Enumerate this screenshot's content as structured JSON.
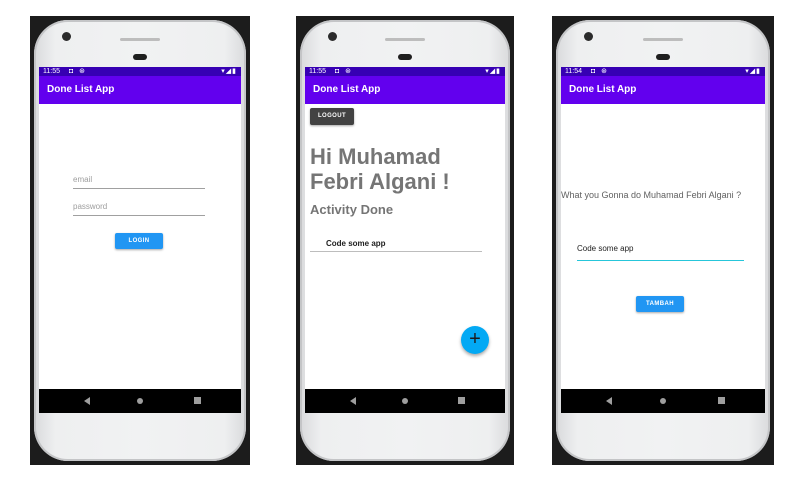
{
  "screens": [
    {
      "status_time": "11:55",
      "status_icons": "◘ ⊛",
      "status_right": "▾◢▮",
      "app_title": "Done List App",
      "email_placeholder": "email",
      "password_placeholder": "password",
      "login_label": "LOGIN"
    },
    {
      "status_time": "11:55",
      "status_icons": "◘ ⊛",
      "status_right": "▾◢▮",
      "app_title": "Done List App",
      "logout_label": "LOGOUT",
      "greeting": "Hi Muhamad Febri Algani !",
      "subtitle": "Activity Done",
      "items": [
        "Code some app"
      ],
      "fab_icon": "+"
    },
    {
      "status_time": "11:54",
      "status_icons": "◘ ⊛",
      "status_right": "▾◢▮",
      "app_title": "Done List App",
      "question": "What you Gonna do Muhamad Febri Algani ?",
      "input_value": "Code some app",
      "add_label": "TAMBAH"
    }
  ],
  "colors": {
    "status_bar": "#3700b3",
    "app_bar": "#6200ee",
    "button": "#2196f3",
    "fab": "#03a9f4",
    "input_accent": "#26c6da"
  },
  "icons": {
    "back": "nav-back-icon",
    "home": "nav-home-icon",
    "recent": "nav-recent-icon",
    "add": "plus-icon"
  }
}
